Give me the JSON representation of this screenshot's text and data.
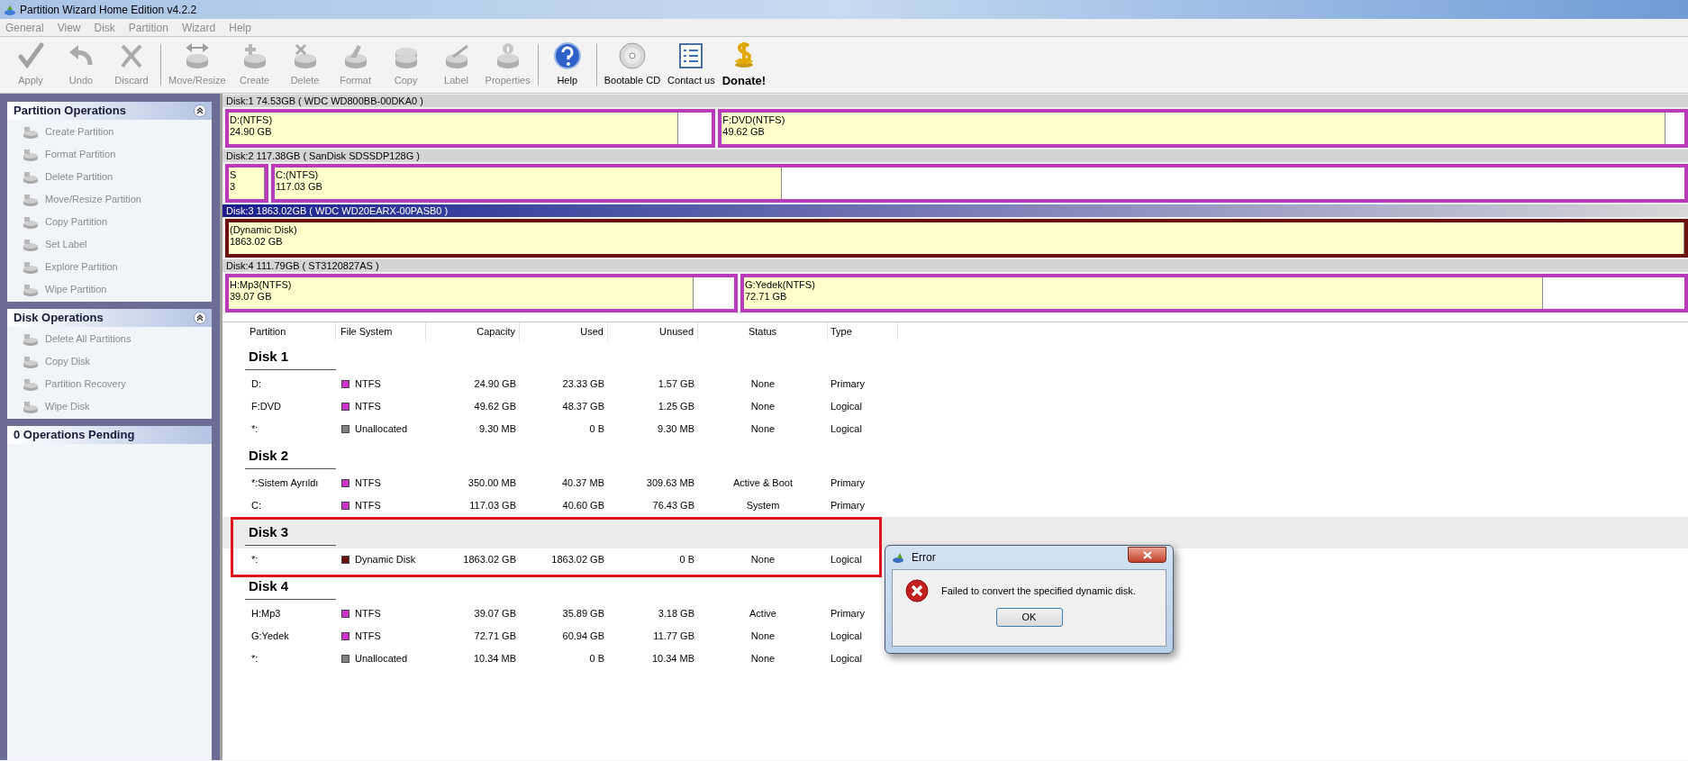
{
  "window": {
    "title": "Partition Wizard Home Edition v4.2.2"
  },
  "menu": [
    "General",
    "View",
    "Disk",
    "Partition",
    "Wizard",
    "Help"
  ],
  "toolbar": {
    "groups": [
      [
        {
          "label": "Apply",
          "kind": "apply",
          "disabled": true
        },
        {
          "label": "Undo",
          "kind": "undo",
          "disabled": true
        },
        {
          "label": "Discard",
          "kind": "discard",
          "disabled": true
        }
      ],
      [
        {
          "label": "Move/Resize",
          "kind": "move",
          "disabled": true
        },
        {
          "label": "Create",
          "kind": "create",
          "disabled": true
        },
        {
          "label": "Delete",
          "kind": "delete",
          "disabled": true
        },
        {
          "label": "Format",
          "kind": "format",
          "disabled": true
        },
        {
          "label": "Copy",
          "kind": "copy",
          "disabled": true
        },
        {
          "label": "Label",
          "kind": "label",
          "disabled": true
        },
        {
          "label": "Properties",
          "kind": "properties",
          "disabled": true
        }
      ],
      [
        {
          "label": "Help",
          "kind": "help",
          "disabled": false
        }
      ],
      [
        {
          "label": "Bootable CD",
          "kind": "cd",
          "disabled": false
        },
        {
          "label": "Contact us",
          "kind": "contact",
          "disabled": false
        },
        {
          "label": "Donate!",
          "kind": "donate",
          "disabled": false
        }
      ]
    ]
  },
  "sidebar": {
    "panels": [
      {
        "title": "Partition Operations",
        "collapsible": true,
        "items": [
          {
            "label": "Create Partition",
            "disabled": true
          },
          {
            "label": "Format Partition",
            "disabled": true
          },
          {
            "label": "Delete Partition",
            "disabled": true
          },
          {
            "label": "Move/Resize Partition",
            "disabled": true
          },
          {
            "label": "Copy Partition",
            "disabled": true
          },
          {
            "label": "Set Label",
            "disabled": true
          },
          {
            "label": "Explore Partition",
            "disabled": true
          },
          {
            "label": "Wipe Partition",
            "disabled": true
          }
        ]
      },
      {
        "title": "Disk Operations",
        "collapsible": true,
        "items": [
          {
            "label": "Delete All Partitions",
            "disabled": true
          },
          {
            "label": "Copy Disk",
            "disabled": true
          },
          {
            "label": "Partition Recovery",
            "disabled": true
          },
          {
            "label": "Wipe Disk",
            "disabled": true
          }
        ]
      },
      {
        "title": "0 Operations Pending",
        "collapsible": false
      }
    ]
  },
  "disk_map": [
    {
      "header": "Disk:1 74.53GB  ( WDC WD800BB-00DKA0 )",
      "selected": false,
      "partitions": [
        {
          "name": "D:(NTFS)",
          "size": "24.90 GB",
          "color": "#b93bb9",
          "level": 0.93
        },
        {
          "name": "F:DVD(NTFS)",
          "size": "49.62 GB",
          "color": "#b93bb9",
          "level": 0.98
        }
      ]
    },
    {
      "header": "Disk:2 117.38GB  ( SanDisk SDSSDP128G )",
      "selected": false,
      "partitions": [
        {
          "name": "S",
          "size": "3",
          "color": "#b93bb9",
          "level": 1
        },
        {
          "name": "C:(NTFS)",
          "size": "117.03 GB",
          "color": "#b93bb9",
          "level": 0.36
        }
      ]
    },
    {
      "header": "Disk:3 1863.02GB  ( WDC WD20EARX-00PASB0 )",
      "selected": true,
      "partitions": [
        {
          "name": "(Dynamic Disk)",
          "size": "1863.02 GB",
          "color": "#6b0f0f",
          "level": 1
        }
      ]
    },
    {
      "header": "Disk:4 111.79GB  ( ST3120827AS )",
      "selected": false,
      "partitions": [
        {
          "name": "H:Mp3(NTFS)",
          "size": "39.07 GB",
          "color": "#b93bb9",
          "level": 0.92
        },
        {
          "name": "G:Yedek(NTFS)",
          "size": "72.71 GB",
          "color": "#b93bb9",
          "level": 0.85
        }
      ]
    }
  ],
  "table": {
    "columns": [
      "Partition",
      "File System",
      "Capacity",
      "Used",
      "Unused",
      "Status",
      "Type"
    ],
    "disks": [
      {
        "title": "Disk 1",
        "selected": false,
        "rows": [
          {
            "partition": "D:",
            "file_system": "NTFS",
            "color": "#cc33cc",
            "capacity": "24.90 GB",
            "used": "23.33 GB",
            "unused": "1.57 GB",
            "status": "None",
            "type": "Primary"
          },
          {
            "partition": "F:DVD",
            "file_system": "NTFS",
            "color": "#cc33cc",
            "capacity": "49.62 GB",
            "used": "48.37 GB",
            "unused": "1.25 GB",
            "status": "None",
            "type": "Logical"
          },
          {
            "partition": "*:",
            "file_system": "Unallocated",
            "color": "#808080",
            "capacity": "9.30 MB",
            "used": "0 B",
            "unused": "9.30 MB",
            "status": "None",
            "type": "Logical"
          }
        ]
      },
      {
        "title": "Disk 2",
        "selected": false,
        "rows": [
          {
            "partition": "*:Sistem Ayrıldı",
            "file_system": "NTFS",
            "color": "#cc33cc",
            "capacity": "350.00 MB",
            "used": "40.37 MB",
            "unused": "309.63 MB",
            "status": "Active & Boot",
            "type": "Primary"
          },
          {
            "partition": "C:",
            "file_system": "NTFS",
            "color": "#cc33cc",
            "capacity": "117.03 GB",
            "used": "40.60 GB",
            "unused": "76.43 GB",
            "status": "System",
            "type": "Primary"
          }
        ]
      },
      {
        "title": "Disk 3",
        "selected": true,
        "rows": [
          {
            "partition": "*:",
            "file_system": "Dynamic Disk",
            "color": "#6b0f0f",
            "capacity": "1863.02 GB",
            "used": "1863.02 GB",
            "unused": "0 B",
            "status": "None",
            "type": "Logical"
          }
        ]
      },
      {
        "title": "Disk 4",
        "selected": false,
        "rows": [
          {
            "partition": "H:Mp3",
            "file_system": "NTFS",
            "color": "#cc33cc",
            "capacity": "39.07 GB",
            "used": "35.89 GB",
            "unused": "3.18 GB",
            "status": "Active",
            "type": "Primary"
          },
          {
            "partition": "G:Yedek",
            "file_system": "NTFS",
            "color": "#cc33cc",
            "capacity": "72.71 GB",
            "used": "60.94 GB",
            "unused": "11.77 GB",
            "status": "None",
            "type": "Logical"
          },
          {
            "partition": "*:",
            "file_system": "Unallocated",
            "color": "#808080",
            "capacity": "10.34 MB",
            "used": "0 B",
            "unused": "10.34 MB",
            "status": "None",
            "type": "Logical"
          }
        ]
      }
    ]
  },
  "dialog": {
    "title": "Error",
    "message": "Failed to convert the specified dynamic disk.",
    "button": "OK"
  }
}
